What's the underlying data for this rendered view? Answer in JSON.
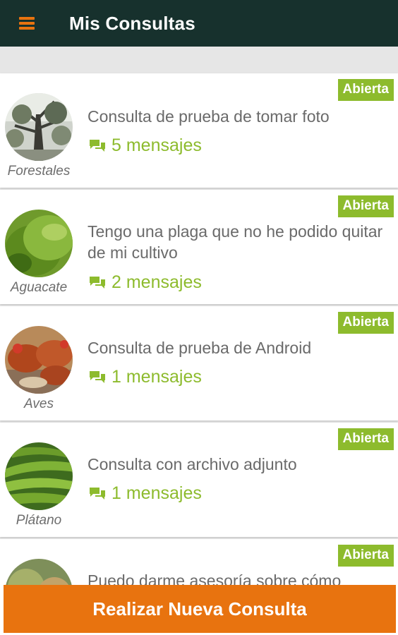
{
  "header": {
    "title": "Mis Consultas",
    "menu_icon": "hamburger-menu-icon"
  },
  "colors": {
    "appbar": "#17312d",
    "accent_orange": "#e8730f",
    "accent_green": "#8dbb2d",
    "text_gray": "#6a6a6a"
  },
  "consultas": [
    {
      "category": "Forestales",
      "title": "Consulta de prueba de tomar foto",
      "messages": "5 mensajes",
      "status": "Abierta"
    },
    {
      "category": "Aguacate",
      "title": "Tengo una plaga que no he podido quitar de mi cultivo",
      "messages": "2 mensajes",
      "status": "Abierta"
    },
    {
      "category": "Aves",
      "title": "Consulta de prueba de Android",
      "messages": "1 mensajes",
      "status": "Abierta"
    },
    {
      "category": "Plátano",
      "title": "Consulta con archivo adjunto",
      "messages": "1 mensajes",
      "status": "Abierta"
    },
    {
      "category": "",
      "title": "Puedo darme asesoría sobre cómo",
      "messages": "",
      "status": "Abierta"
    }
  ],
  "footer": {
    "button_label": "Realizar Nueva Consulta"
  }
}
